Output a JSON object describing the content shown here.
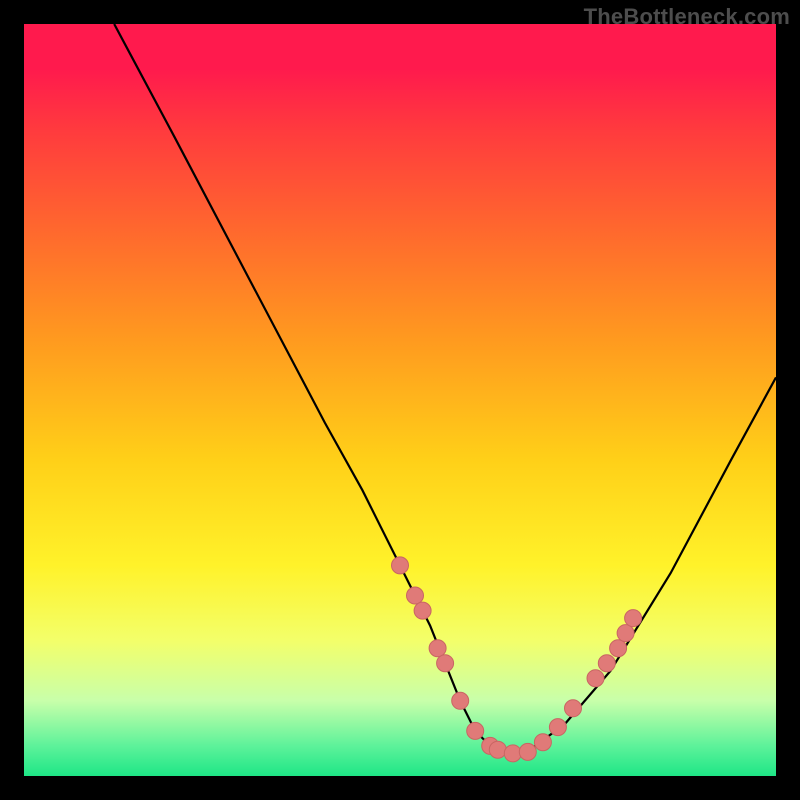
{
  "watermark": "TheBottleneck.com",
  "colors": {
    "frame": "#000000",
    "gradient_top": "#ff1a4d",
    "gradient_bottom": "#1ee686",
    "curve": "#000000",
    "marker_fill": "#e07a78",
    "marker_stroke": "#c96563"
  },
  "chart_data": {
    "type": "line",
    "title": "",
    "xlabel": "",
    "ylabel": "",
    "xlim": [
      0,
      100
    ],
    "ylim": [
      0,
      100
    ],
    "series": [
      {
        "name": "curve",
        "x": [
          12,
          20,
          30,
          40,
          45,
          50,
          54,
          56,
          58,
          60,
          62,
          64,
          66,
          68,
          72,
          78,
          86,
          94,
          100
        ],
        "y": [
          100,
          85,
          66,
          47,
          38,
          28,
          20,
          15,
          10,
          6,
          4,
          3,
          3,
          4,
          7,
          14,
          27,
          42,
          53
        ]
      }
    ],
    "markers": [
      {
        "x": 50,
        "y": 28
      },
      {
        "x": 52,
        "y": 24
      },
      {
        "x": 53,
        "y": 22
      },
      {
        "x": 55,
        "y": 17
      },
      {
        "x": 56,
        "y": 15
      },
      {
        "x": 58,
        "y": 10
      },
      {
        "x": 60,
        "y": 6
      },
      {
        "x": 62,
        "y": 4
      },
      {
        "x": 63,
        "y": 3.5
      },
      {
        "x": 65,
        "y": 3
      },
      {
        "x": 67,
        "y": 3.2
      },
      {
        "x": 69,
        "y": 4.5
      },
      {
        "x": 71,
        "y": 6.5
      },
      {
        "x": 73,
        "y": 9
      },
      {
        "x": 76,
        "y": 13
      },
      {
        "x": 77.5,
        "y": 15
      },
      {
        "x": 79,
        "y": 17
      },
      {
        "x": 80,
        "y": 19
      },
      {
        "x": 81,
        "y": 21
      }
    ]
  }
}
